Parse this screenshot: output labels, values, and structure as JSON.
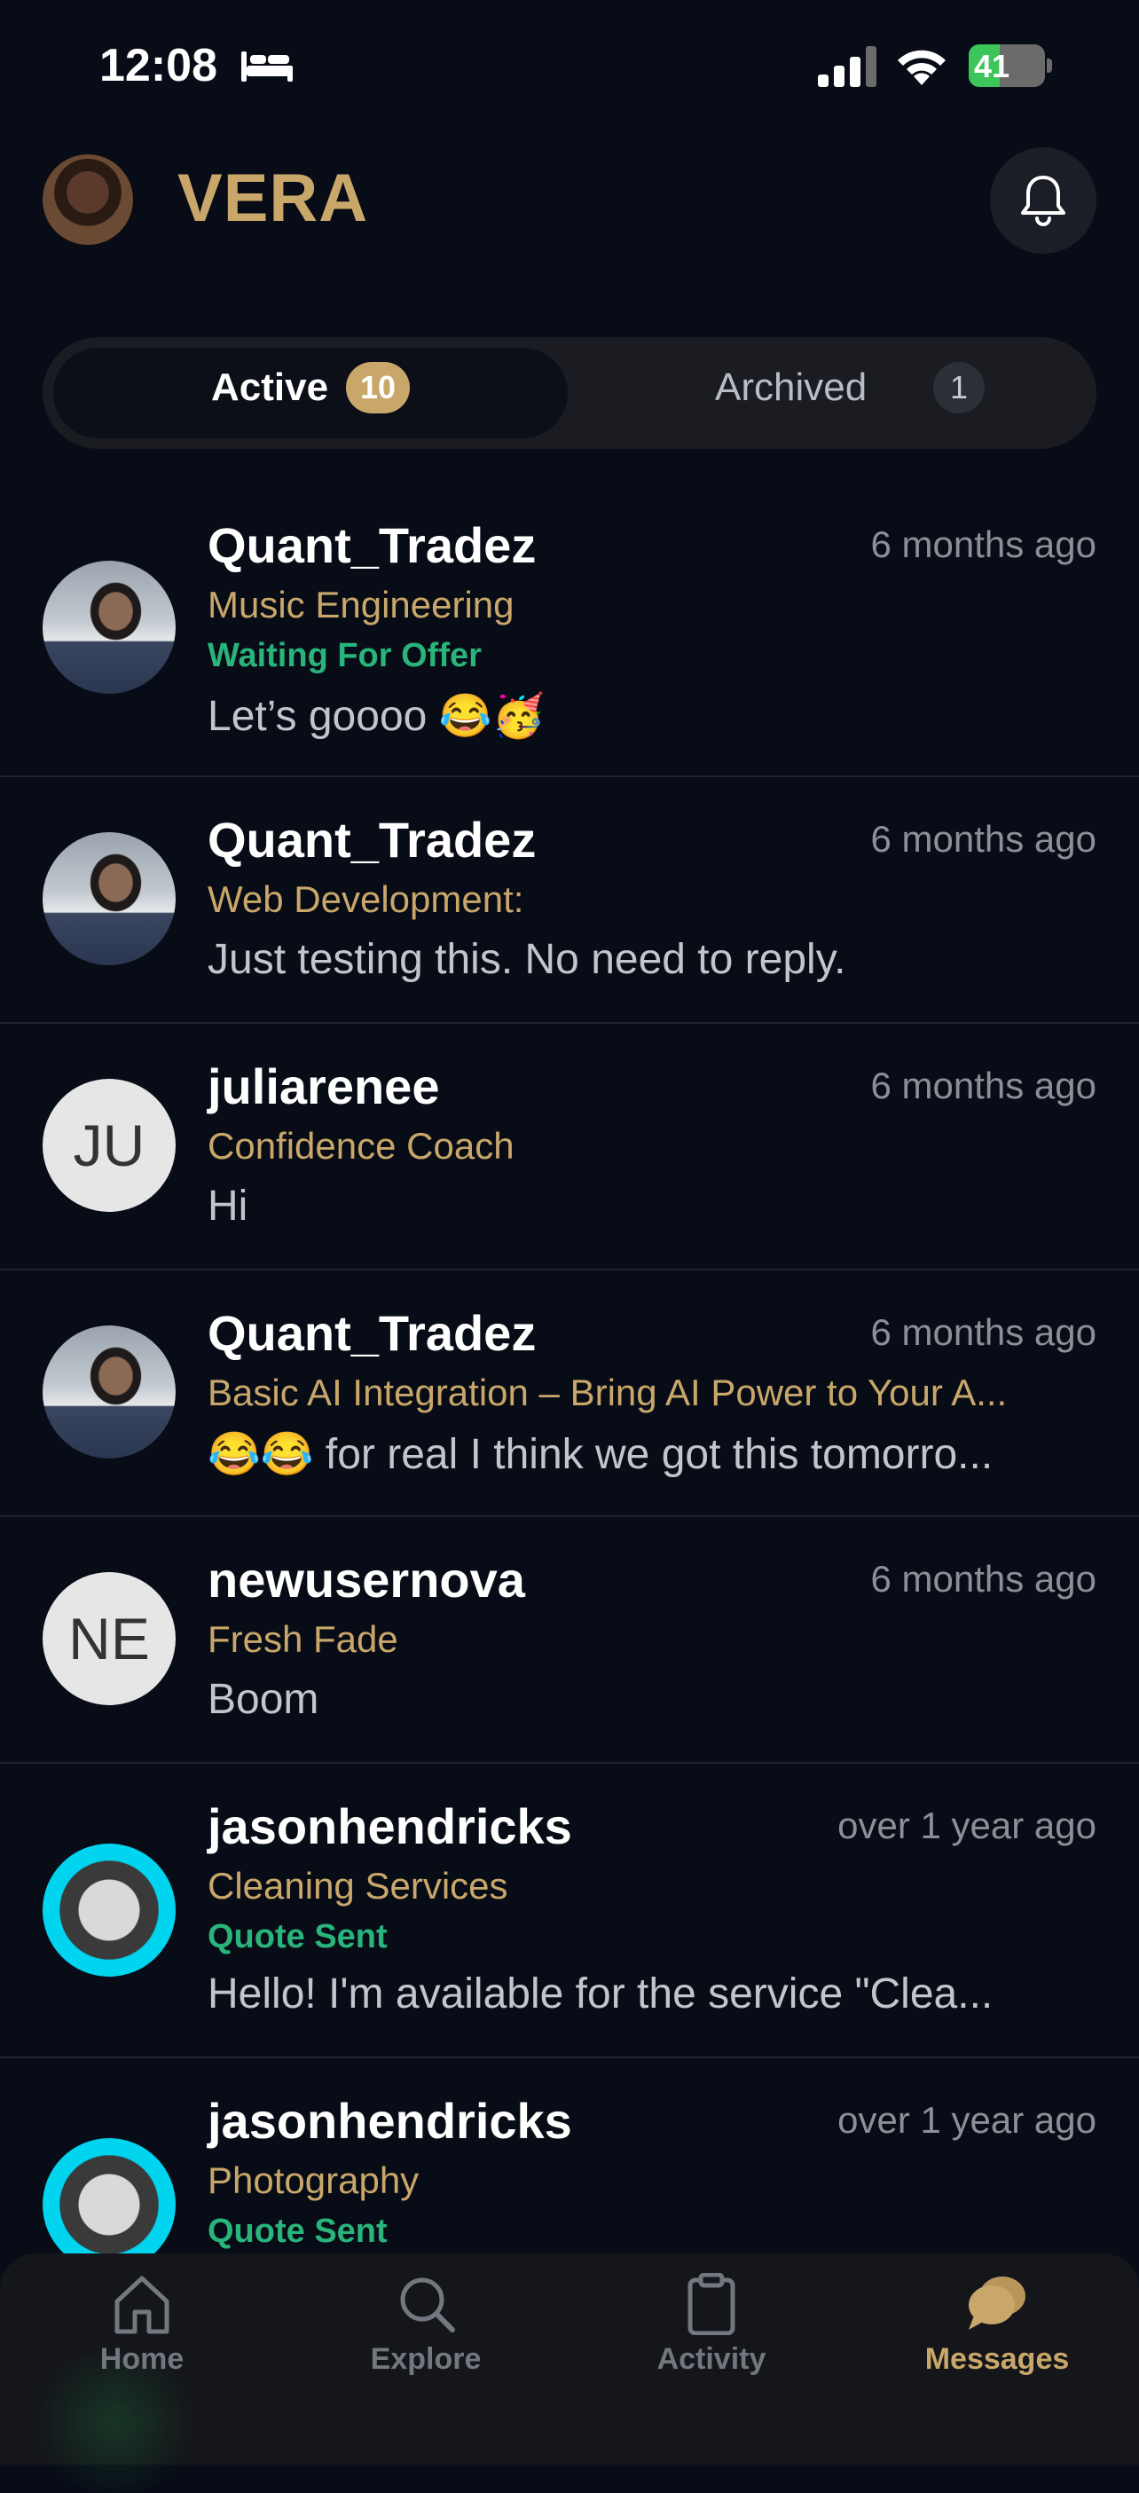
{
  "status_bar": {
    "time": "12:08",
    "battery": "41",
    "battery_level": 0.41
  },
  "header": {
    "title": "VERA"
  },
  "tabs": {
    "active_label": "Active",
    "active_count": "10",
    "archived_label": "Archived",
    "archived_count": "1"
  },
  "conversations": [
    {
      "name": "Quant_Tradez",
      "time": "6 months ago",
      "service": "Music Engineering",
      "status": "Waiting For Offer",
      "preview": "Let’s goooo 😂🥳"
    },
    {
      "name": "Quant_Tradez",
      "time": "6 months ago",
      "service": "Web Development:",
      "status": "",
      "preview": "Just testing this. No need to reply."
    },
    {
      "name": "juliarenee",
      "time": "6 months ago",
      "service": "Confidence Coach",
      "status": "",
      "preview": "Hi",
      "initials": "JU"
    },
    {
      "name": "Quant_Tradez",
      "time": "6 months ago",
      "service": "Basic AI Integration – Bring AI Power to Your A...",
      "status": "",
      "preview": "😂😂 for real I think we got this tomorro..."
    },
    {
      "name": "newusernova",
      "time": "6 months ago",
      "service": "Fresh Fade",
      "status": "",
      "preview": "Boom",
      "initials": "NE"
    },
    {
      "name": "jasonhendricks",
      "time": "over 1 year ago",
      "service": "Cleaning Services",
      "status": "Quote Sent",
      "preview": "Hello! I'm available for the service \"Clea..."
    },
    {
      "name": "jasonhendricks",
      "time": "over 1 year ago",
      "service": "Photography",
      "status": "Quote Sent",
      "preview": ""
    }
  ],
  "nav": {
    "home": "Home",
    "explore": "Explore",
    "activity": "Activity",
    "messages": "Messages"
  },
  "colors": {
    "accent": "#c9a76a",
    "status_green": "#28b47a",
    "background": "#080c16"
  }
}
